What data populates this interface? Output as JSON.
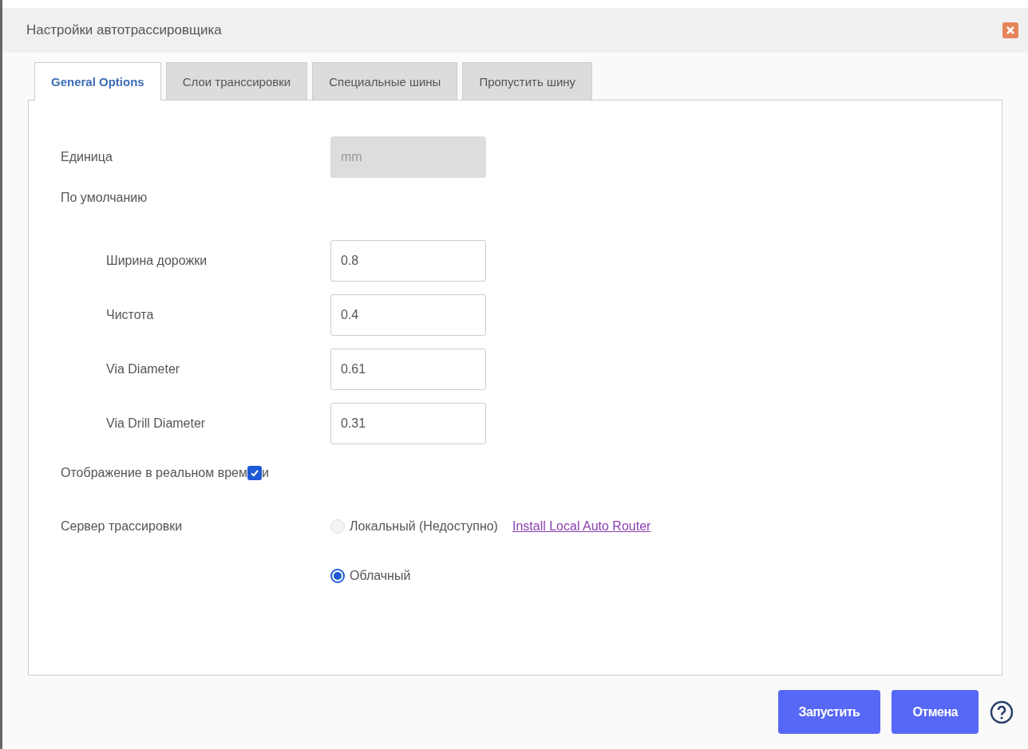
{
  "window": {
    "title": "Настройки автотрассировщика"
  },
  "tabs": [
    {
      "label": "General Options",
      "selected": true
    },
    {
      "label": "Слои транссировки",
      "selected": false
    },
    {
      "label": "Специальные шины",
      "selected": false
    },
    {
      "label": "Пропустить шину",
      "selected": false
    }
  ],
  "unit": {
    "label": "Единица",
    "value": "mm",
    "disabled": true
  },
  "defaults": {
    "label": "По умолчанию",
    "fields": [
      {
        "label": "Ширина дорожки",
        "value": "0.8"
      },
      {
        "label": "Чистота",
        "value": "0.4"
      },
      {
        "label": "Via Diameter",
        "value": "0.61"
      },
      {
        "label": "Via Drill Diameter",
        "value": "0.31"
      }
    ]
  },
  "realtime": {
    "label": "Отображение в реальном врем",
    "label_tail": "и",
    "checked": true
  },
  "server": {
    "label": "Сервер трассировки",
    "options": [
      {
        "label": "Локальный (Недоступно)",
        "selected": false,
        "disabled": true,
        "link": "Install Local Auto Router"
      },
      {
        "label": "Облачный",
        "selected": true,
        "disabled": false
      }
    ]
  },
  "buttons": [
    "Запустить",
    "Отмена"
  ]
}
